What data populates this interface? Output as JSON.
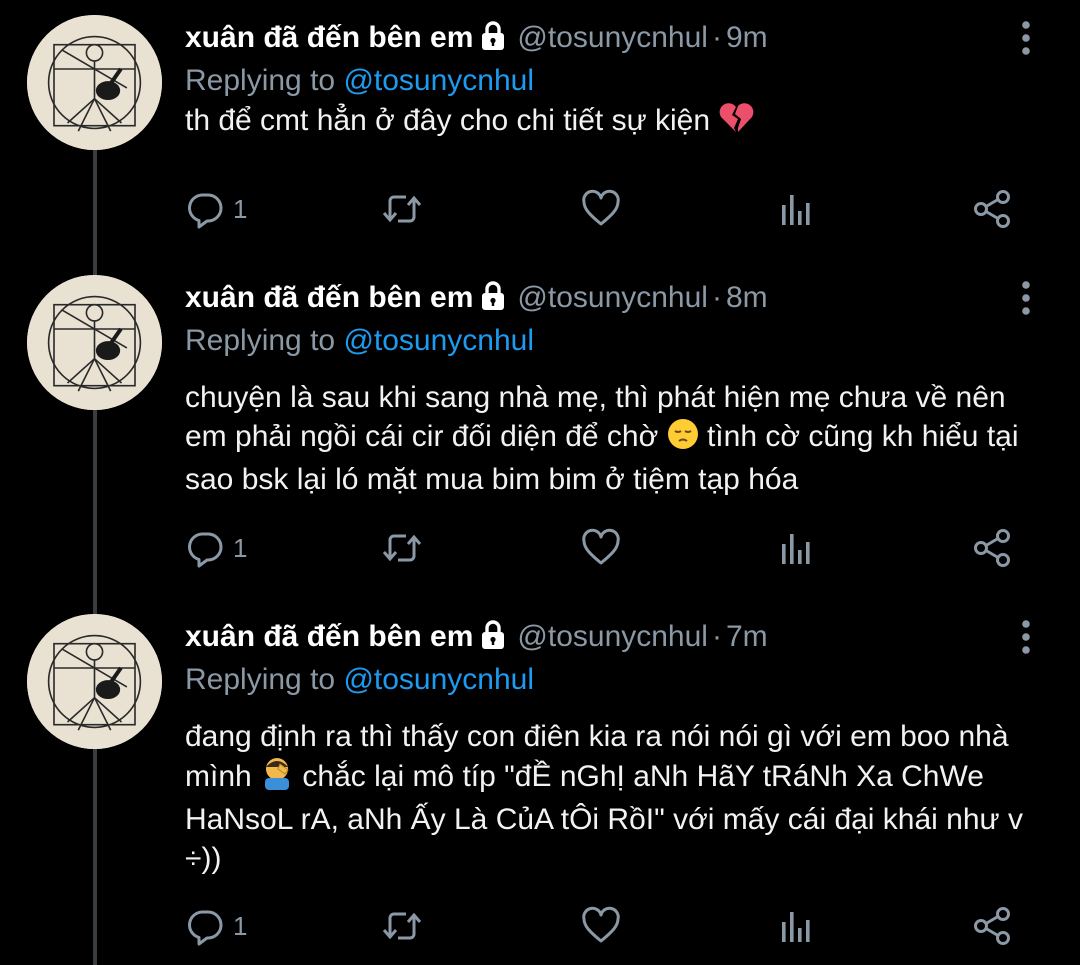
{
  "tweets": [
    {
      "name": "xuân đã đến bên em",
      "handle": "@tosunycnhul",
      "dot": "·",
      "time": "9m",
      "replying_prefix": "Replying to",
      "replying_handle": "@tosunycnhul",
      "text_parts": [
        "th để cmt hẳn ở đây cho chi tiết sự kiện"
      ],
      "emoji": [
        "broken-heart-emoji"
      ],
      "reply_count": "1"
    },
    {
      "name": "xuân đã đến bên em",
      "handle": "@tosunycnhul",
      "dot": "·",
      "time": "8m",
      "replying_prefix": "Replying to",
      "replying_handle": "@tosunycnhul",
      "text_parts": [
        "chuyện là sau khi sang nhà mẹ, thì phát hiện mẹ chưa về nên em phải ngồi cái cir đối diện để chờ",
        "tình cờ cũng kh hiểu tại sao bsk lại ló mặt mua bim bim ở tiệm tạp hóa"
      ],
      "emoji": [
        "pensive-face-emoji"
      ],
      "reply_count": "1"
    },
    {
      "name": "xuân đã đến bên em",
      "handle": "@tosunycnhul",
      "dot": "·",
      "time": "7m",
      "replying_prefix": "Replying to",
      "replying_handle": "@tosunycnhul",
      "text_parts": [
        "đang định ra thì thấy con điên kia ra nói nói gì với em boo nhà mình",
        "chắc lại mô típ \"đỀ nGhỊ aNh HãY tRáNh Xa ChWe HaNsoL rA, aNh Ấy Là CủA tÔi RồI\" với mấy cái đại khái như v ÷))"
      ],
      "emoji": [
        "facepalm-emoji"
      ],
      "reply_count": "1"
    }
  ],
  "colors": {
    "background": "#000000",
    "secondary_text": "#8b98a5",
    "link": "#1d9bf0",
    "thread_line": "#3a3d40"
  },
  "icons": {
    "lock": "lock-icon",
    "more": "more-vertical-icon",
    "reply": "reply-icon",
    "retweet": "retweet-icon",
    "like": "like-icon",
    "analytics": "analytics-icon",
    "share": "share-icon"
  }
}
